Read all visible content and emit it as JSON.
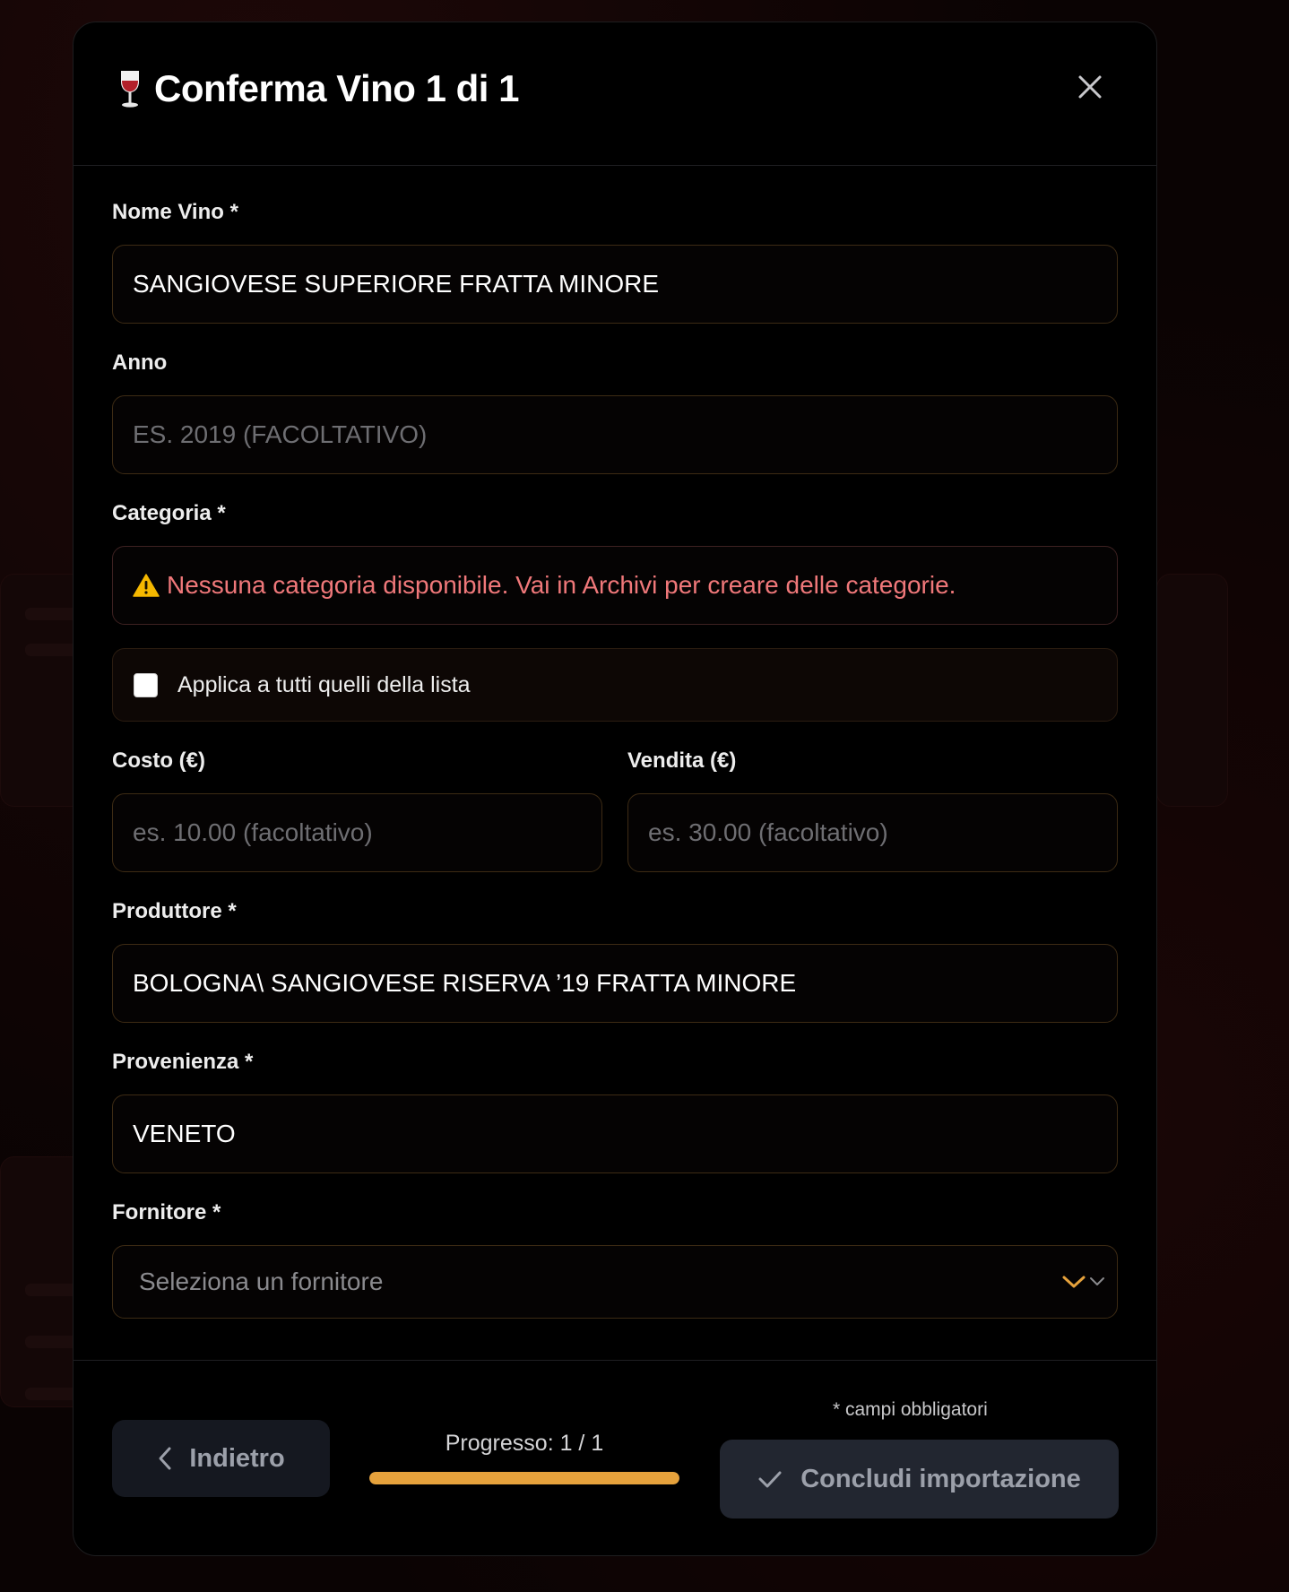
{
  "modal": {
    "title": "Conferma Vino 1 di 1",
    "title_icon": "wine-glass-icon",
    "close_icon": "close-icon"
  },
  "fields": {
    "nome_vino": {
      "label": "Nome Vino *",
      "value": "SANGIOVESE SUPERIORE FRATTA MINORE"
    },
    "anno": {
      "label": "Anno",
      "value": "",
      "placeholder": "ES. 2019 (FACOLTATIVO)"
    },
    "categoria": {
      "label": "Categoria *",
      "warning": "Nessuna categoria disponibile. Vai in Archivi per creare delle categorie.",
      "warning_icon": "warning-icon"
    },
    "apply_all": {
      "label": "Applica a tutti quelli della lista",
      "checked": false
    },
    "costo": {
      "label": "Costo (€)",
      "value": "",
      "placeholder": "es. 10.00 (facoltativo)"
    },
    "vendita": {
      "label": "Vendita (€)",
      "value": "",
      "placeholder": "es. 30.00 (facoltativo)"
    },
    "produttore": {
      "label": "Produttore *",
      "value": "BOLOGNA\\ SANGIOVESE RISERVA ’19 FRATTA MINORE"
    },
    "provenienza": {
      "label": "Provenienza *",
      "value": "VENETO"
    },
    "fornitore": {
      "label": "Fornitore *",
      "placeholder": "Seleziona un fornitore",
      "selected": ""
    }
  },
  "footer": {
    "back_label": "Indietro",
    "progress_label": "Progresso: 1 / 1",
    "progress": 1.0,
    "required_note": "* campi obbligatori",
    "finish_label": "Concludi importazione"
  },
  "colors": {
    "accent": "#e6a23c",
    "warning_text": "#f0787a",
    "button_bg": "#222630"
  }
}
